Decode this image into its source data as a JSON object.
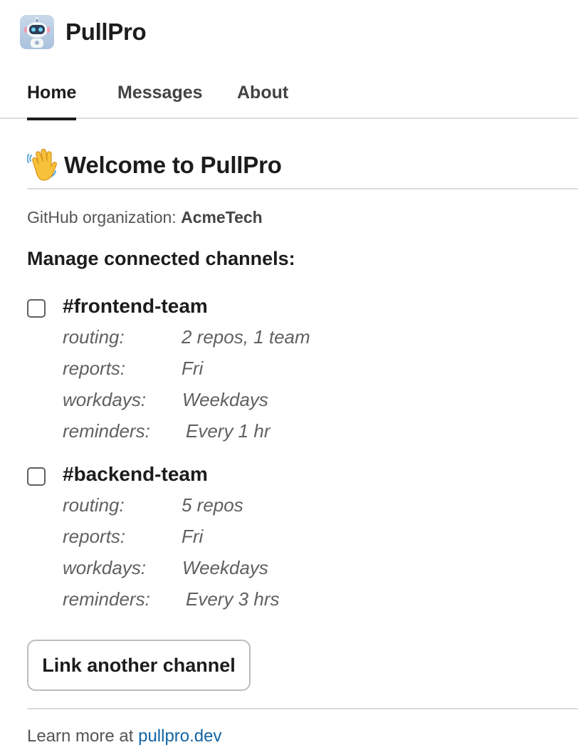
{
  "app": {
    "name": "PullPro",
    "icon": "robot-icon"
  },
  "tabs": [
    {
      "label": "Home",
      "active": true
    },
    {
      "label": "Messages",
      "active": false
    },
    {
      "label": "About",
      "active": false
    }
  ],
  "welcome": {
    "emoji": "waving-hand-icon",
    "title": "Welcome to PullPro"
  },
  "org": {
    "label": "GitHub organization:",
    "name": "AcmeTech"
  },
  "manage_heading": "Manage connected channels:",
  "channels": [
    {
      "name": "#frontend-team",
      "checked": false,
      "routing_label": "routing:",
      "routing": "2 repos, 1 team",
      "reports_label": "reports:",
      "reports": "Fri",
      "workdays_label": "workdays:",
      "workdays": "Weekdays",
      "reminders_label": "reminders:",
      "reminders": "Every 1 hr"
    },
    {
      "name": "#backend-team",
      "checked": false,
      "routing_label": "routing:",
      "routing": "5 repos",
      "reports_label": "reports:",
      "reports": "Fri",
      "workdays_label": "workdays:",
      "workdays": "Weekdays",
      "reminders_label": "reminders:",
      "reminders": "Every 3 hrs"
    }
  ],
  "link_button": "Link another channel",
  "footer": {
    "text": "Learn more at",
    "link": "pullpro.dev"
  },
  "colors": {
    "link": "#1264a3",
    "text": "#1d1c1d",
    "muted": "#616061",
    "divider": "#dddddd"
  }
}
